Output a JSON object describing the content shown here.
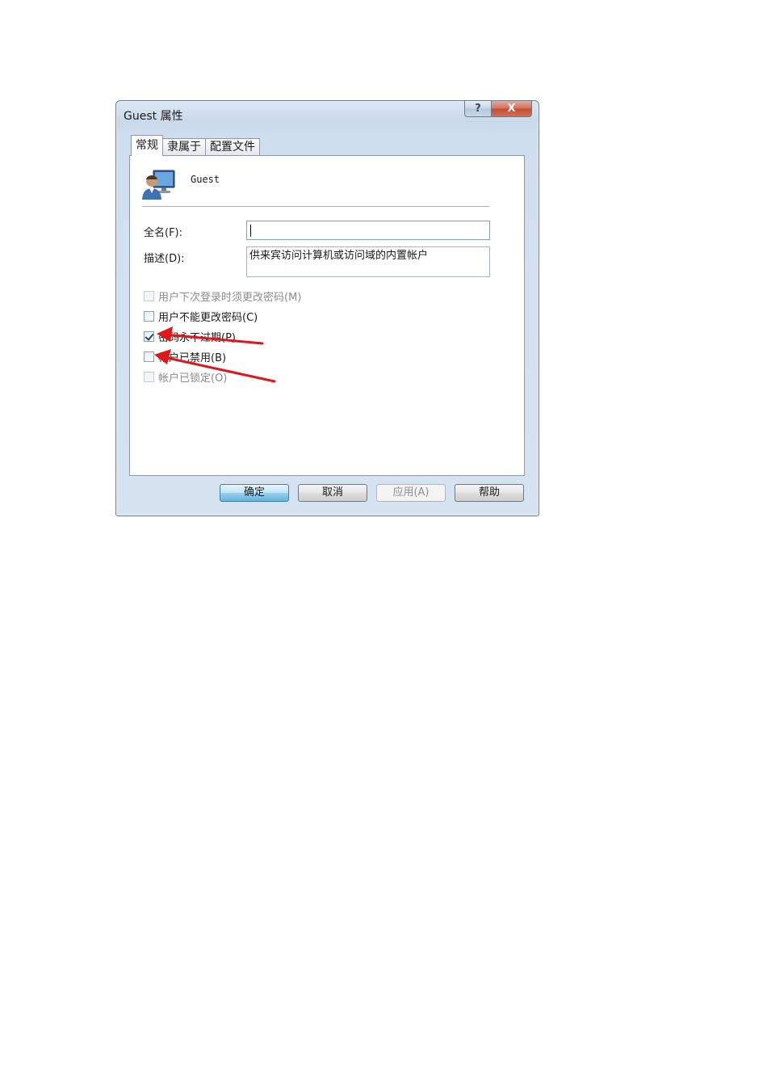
{
  "window": {
    "title": "Guest 属性",
    "help_glyph": "?",
    "close_glyph": "X"
  },
  "tabs": [
    {
      "label": "常规",
      "active": true
    },
    {
      "label": "隶属于",
      "active": false
    },
    {
      "label": "配置文件",
      "active": false
    }
  ],
  "user": {
    "name": "Guest",
    "icon": "user-monitor-icon"
  },
  "fields": {
    "full_name_label": "全名(F):",
    "full_name_value": "",
    "description_label": "描述(D):",
    "description_value": "供来宾访问计算机或访问域的内置帐户"
  },
  "checkboxes": [
    {
      "label": "用户下次登录时须更改密码(M)",
      "checked": false,
      "enabled": false
    },
    {
      "label": "用户不能更改密码(C)",
      "checked": false,
      "enabled": true
    },
    {
      "label": "密码永不过期(P)",
      "checked": true,
      "enabled": true
    },
    {
      "label": "帐户已禁用(B)",
      "checked": false,
      "enabled": true
    },
    {
      "label": "帐户已锁定(O)",
      "checked": false,
      "enabled": false
    }
  ],
  "buttons": {
    "ok": "确定",
    "cancel": "取消",
    "apply": "应用(A)",
    "help": "帮助"
  },
  "colors": {
    "annotation_arrow": "#e0161d"
  }
}
